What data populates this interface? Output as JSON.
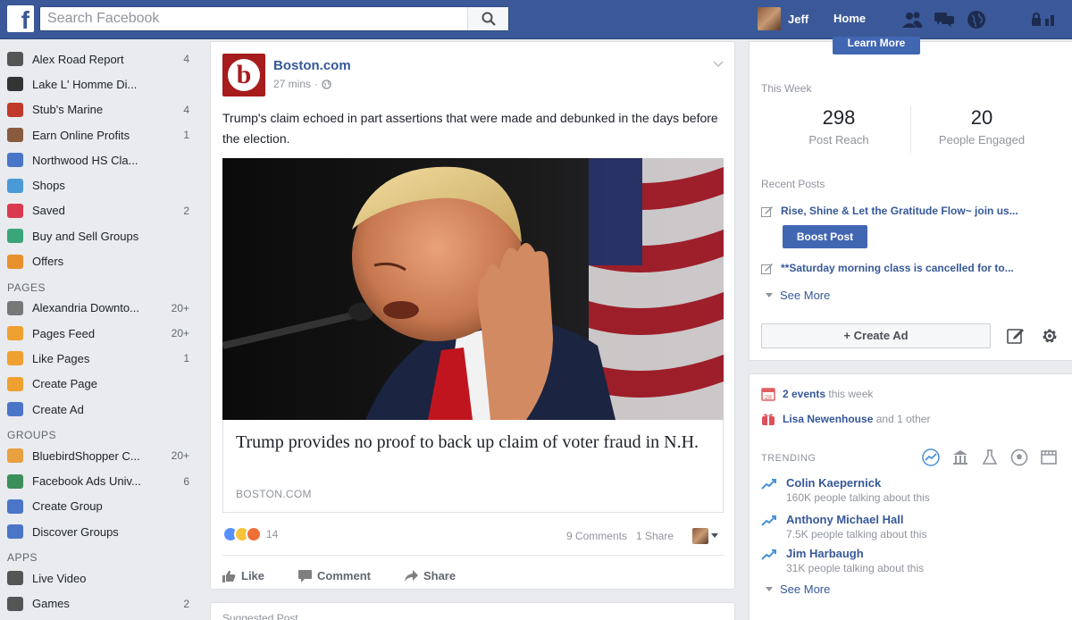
{
  "topbar": {
    "logo": "f",
    "search_placeholder": "Search Facebook",
    "user_name": "Jeff",
    "home_label": "Home"
  },
  "sidebar": {
    "items": [
      {
        "label": "Alex Road Report",
        "count": "4",
        "color": "#555"
      },
      {
        "label": "Lake L' Homme Di...",
        "count": "",
        "color": "#333"
      },
      {
        "label": "Stub's Marine",
        "count": "4",
        "color": "#c0392b"
      },
      {
        "label": "Earn Online Profits",
        "count": "1",
        "color": "#8a5a3c"
      },
      {
        "label": "Northwood HS Cla...",
        "count": "",
        "color": "#4a76c8"
      },
      {
        "label": "Shops",
        "count": "",
        "color": "#4a9ad8"
      },
      {
        "label": "Saved",
        "count": "2",
        "color": "#d93a50"
      },
      {
        "label": "Buy and Sell Groups",
        "count": "",
        "color": "#3aa57a"
      },
      {
        "label": "Offers",
        "count": "",
        "color": "#e8912c"
      }
    ],
    "pages_heading": "PAGES",
    "pages": [
      {
        "label": "Alexandria Downto...",
        "count": "20+",
        "color": "#777"
      },
      {
        "label": "Pages Feed",
        "count": "20+",
        "color": "#f0a030"
      },
      {
        "label": "Like Pages",
        "count": "1",
        "color": "#f0a030"
      },
      {
        "label": "Create Page",
        "count": "",
        "color": "#f0a030"
      },
      {
        "label": "Create Ad",
        "count": "",
        "color": "#4a76c8"
      }
    ],
    "groups_heading": "GROUPS",
    "groups": [
      {
        "label": "BluebirdShopper C...",
        "count": "20+",
        "color": "#e8a040"
      },
      {
        "label": "Facebook Ads Univ...",
        "count": "6",
        "color": "#3a8f5a"
      },
      {
        "label": "Create Group",
        "count": "",
        "color": "#4a76c8"
      },
      {
        "label": "Discover Groups",
        "count": "",
        "color": "#4a76c8"
      }
    ],
    "apps_heading": "APPS",
    "apps": [
      {
        "label": "Live Video",
        "count": "",
        "color": "#555"
      },
      {
        "label": "Games",
        "count": "2",
        "color": "#555"
      }
    ]
  },
  "post": {
    "page_name": "Boston.com",
    "logo_letter": "b",
    "time": "27 mins",
    "text": "Trump's claim echoed in part assertions that were made and debunked in the days before the election.",
    "link_title": "Trump provides no proof to back up claim of voter fraud in N.H.",
    "link_domain": "BOSTON.COM",
    "reaction_count": "14",
    "comments": "9 Comments",
    "shares": "1 Share",
    "actions": {
      "like": "Like",
      "comment": "Comment",
      "share": "Share"
    }
  },
  "suggested": {
    "label": "Suggested Post"
  },
  "insights": {
    "learn_more": "Learn More",
    "this_week": "This Week",
    "post_reach_value": "298",
    "post_reach_label": "Post Reach",
    "engaged_value": "20",
    "engaged_label": "People Engaged",
    "recent_heading": "Recent Posts",
    "recent_posts": [
      "Rise, Shine & Let the Gratitude Flow~ join us...",
      "**Saturday morning class is cancelled for to..."
    ],
    "boost_label": "Boost Post",
    "see_more": "See More",
    "create_ad": "+ Create Ad"
  },
  "events": {
    "count_text": "2 events",
    "this_week": "this week",
    "birthday_name": "Lisa Newenhouse",
    "birthday_rest": "and 1 other"
  },
  "trending": {
    "heading": "TRENDING",
    "items": [
      {
        "name": "Colin Kaepernick",
        "sub": "160K people talking about this"
      },
      {
        "name": "Anthony Michael Hall",
        "sub": "7.5K people talking about this"
      },
      {
        "name": "Jim Harbaugh",
        "sub": "31K people talking about this"
      }
    ],
    "see_more": "See More"
  },
  "colors": {
    "brand": "#3b5998",
    "link": "#365899",
    "button": "#4267b2"
  }
}
